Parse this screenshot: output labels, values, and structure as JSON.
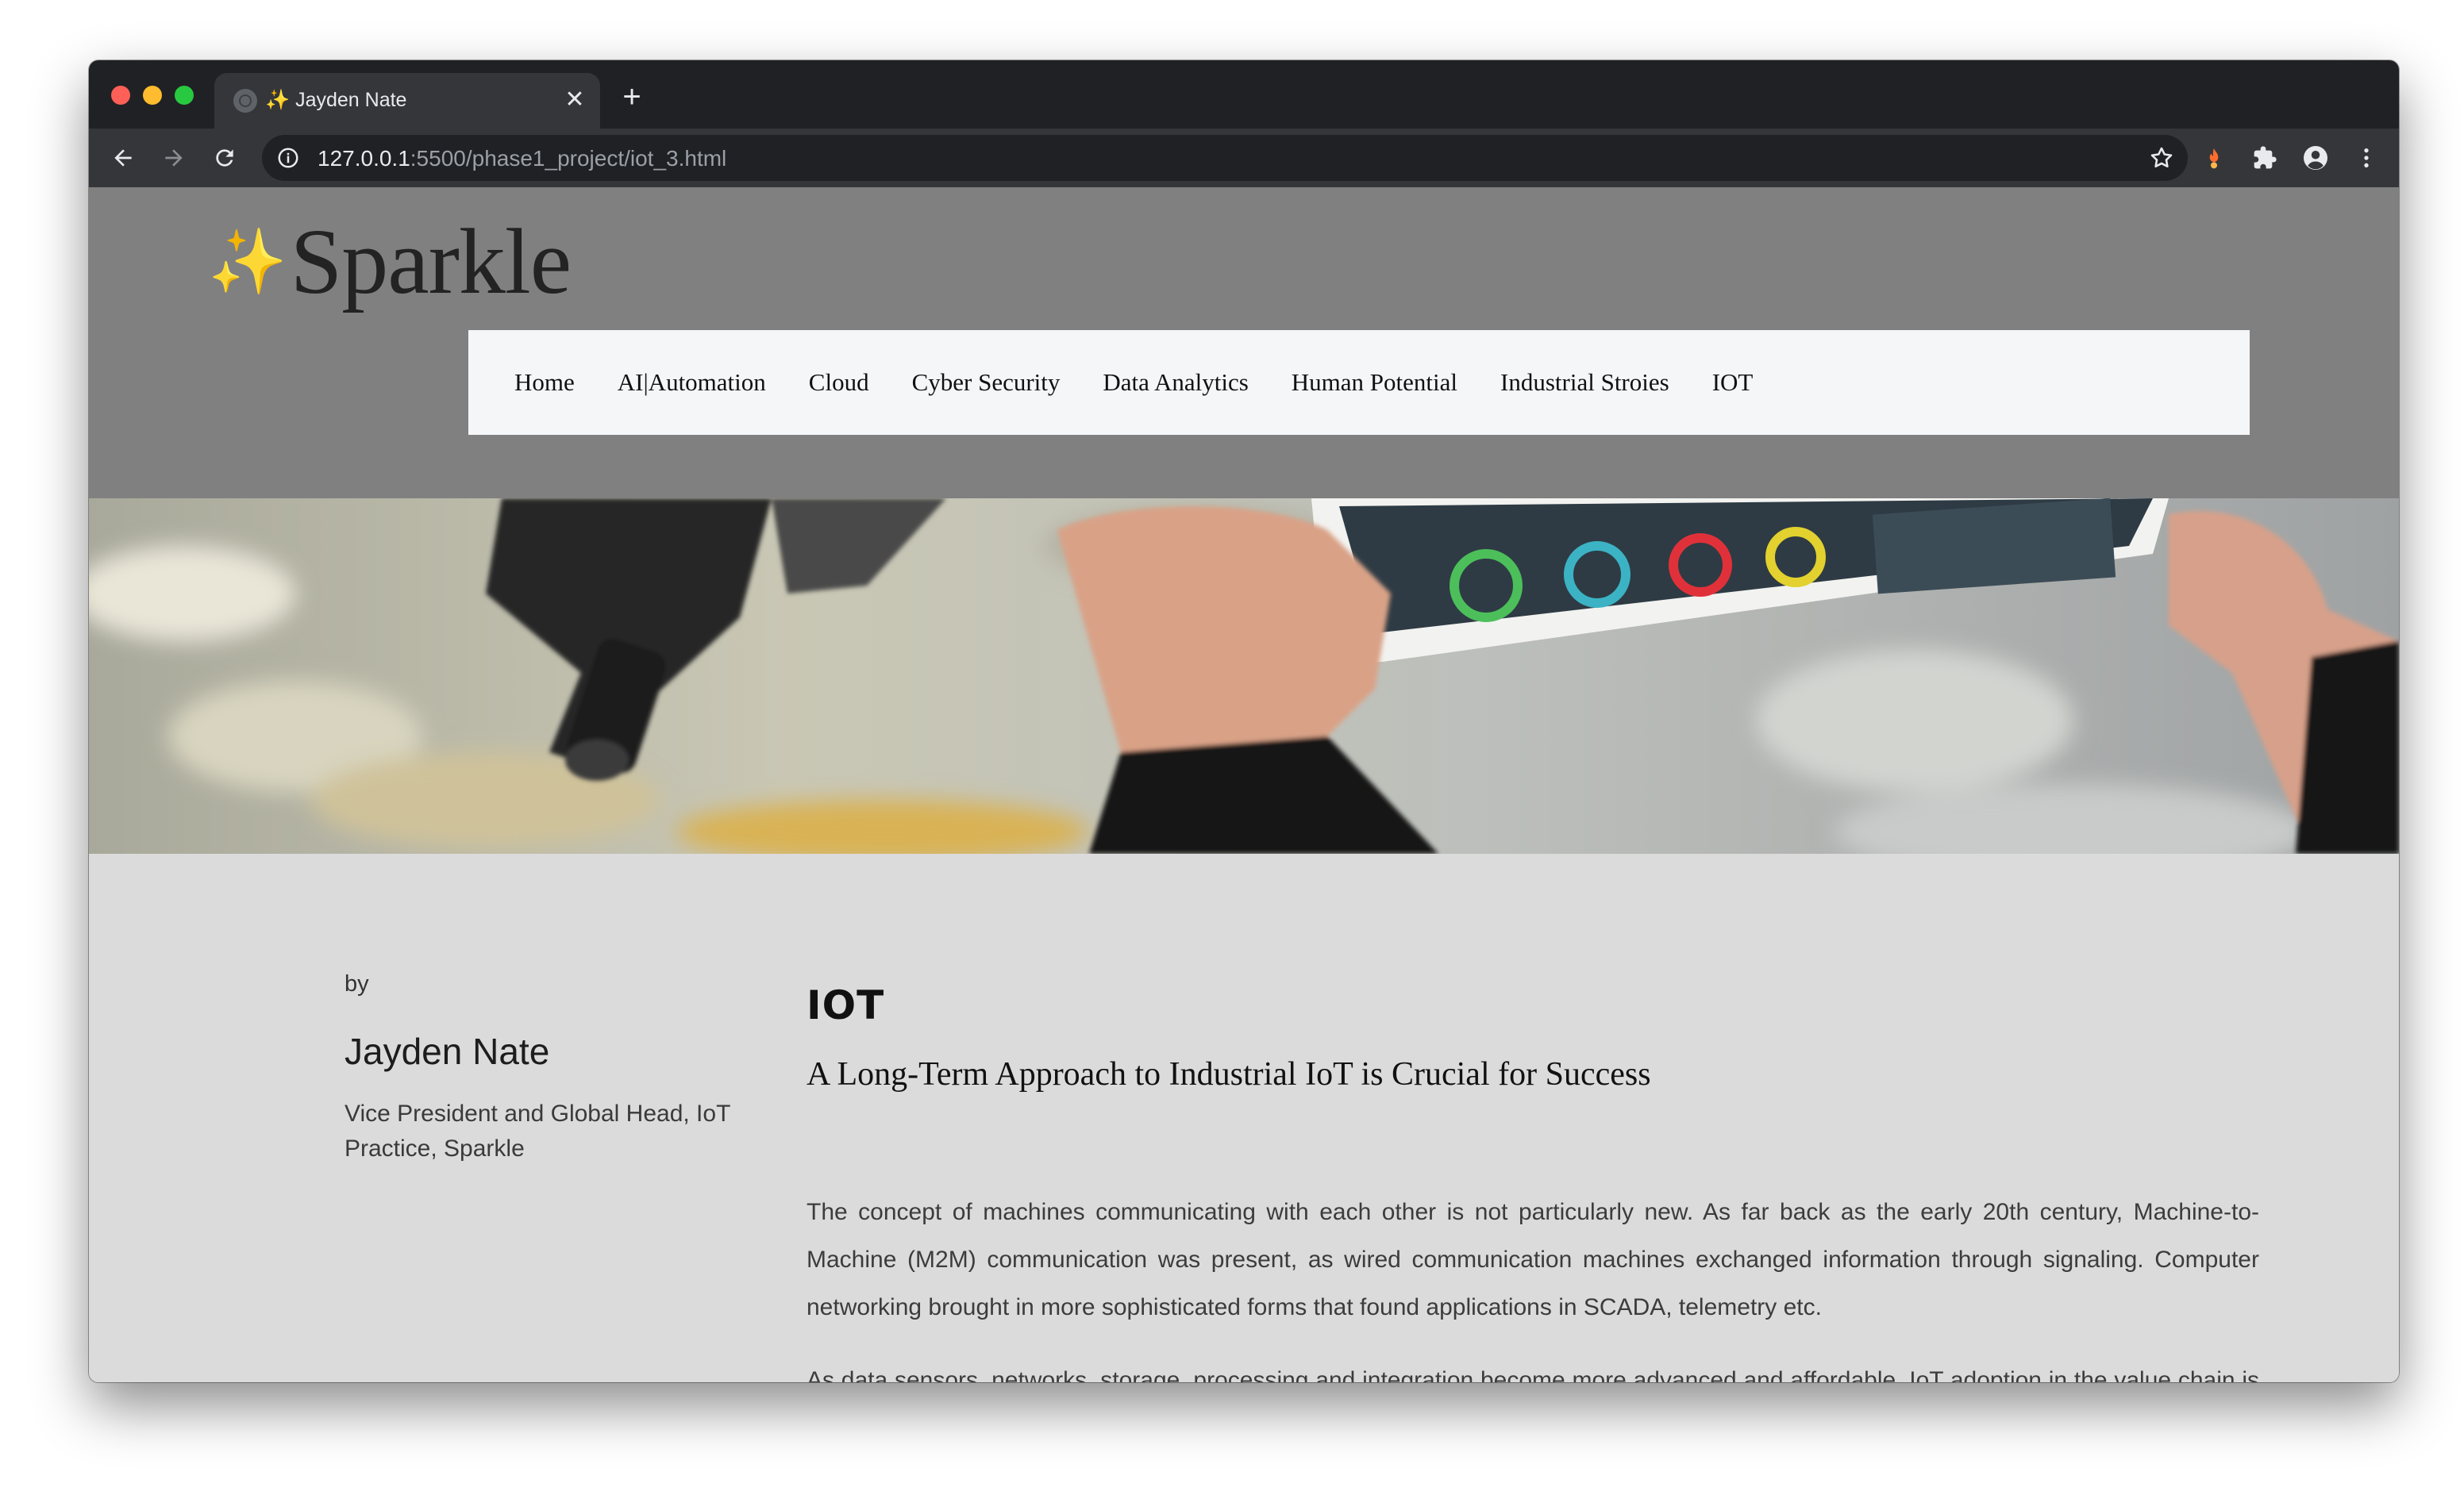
{
  "browser": {
    "tab": {
      "favicon_emoji": "✨",
      "title": "Jayden Nate",
      "close": "✕"
    },
    "new_tab": "+",
    "toolbar": {
      "url_host": "127.0.0.1",
      "url_path": ":5500/phase1_project/iot_3.html"
    }
  },
  "site": {
    "logo_sparkle": "✨",
    "logo_text": "Sparkle",
    "nav": [
      "Home",
      "AI|Automation",
      "Cloud",
      "Cyber Security",
      "Data Analytics",
      "Human Potential",
      "Industrial Stroies",
      "IOT"
    ]
  },
  "author": {
    "by": "by",
    "name": "Jayden Nate",
    "role": "Vice President and Global Head, IoT Practice, Sparkle"
  },
  "article": {
    "tag": "IOT",
    "title": "A Long-Term Approach to Industrial IoT is Crucial for Success",
    "paragraphs": [
      "The concept of machines communicating with each other is not particularly new. As far back as the early 20th century, Machine-to-Machine (M2M) communication was present, as wired communication machines exchanged information through signaling. Computer networking brought in more sophisticated forms that found applications in SCADA, telemetry etc.",
      "As data sensors, networks, storage, processing and integration become more advanced and affordable, IoT adoption in the value chain is set to skyrocket. Our new-world approach to the Industrial IoT is basically an attempt to give it a better structure, so that it is"
    ]
  },
  "colors": {
    "header_bg": "#808080",
    "nav_bg": "#f5f6f8",
    "content_bg": "#dcdbdc",
    "chrome_dark": "#202124",
    "chrome_toolbar": "#35363a"
  }
}
